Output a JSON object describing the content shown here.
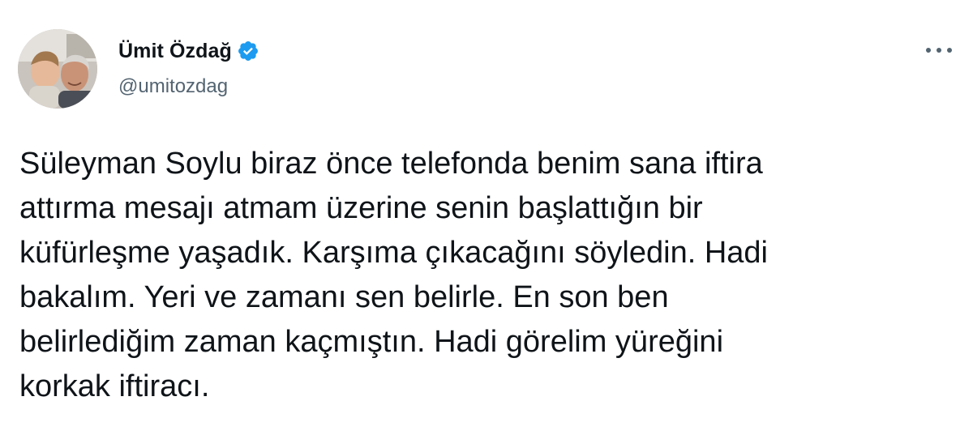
{
  "author": {
    "display_name": "Ümit Özdağ",
    "handle": "@umitozdag",
    "verified": true,
    "avatar_icon": "profile-photo"
  },
  "menu": {
    "icon": "more-horizontal-icon"
  },
  "tweet": {
    "text_lines": [
      "Süleyman Soylu biraz önce telefonda benim sana iftira",
      "attırma mesajı atmam üzerine senin başlattığın bir",
      "küfürleşme yaşadık. Karşıma çıkacağını söyledin. Hadi",
      "bakalım. Yeri ve zamanı sen belirle. En son ben",
      "belirlediğim zaman kaçmıştın. Hadi görelim yüreğini",
      "korkak iftiracı."
    ]
  },
  "colors": {
    "text_primary": "#0f1419",
    "text_secondary": "#536471",
    "verified_blue": "#1d9bf0"
  }
}
